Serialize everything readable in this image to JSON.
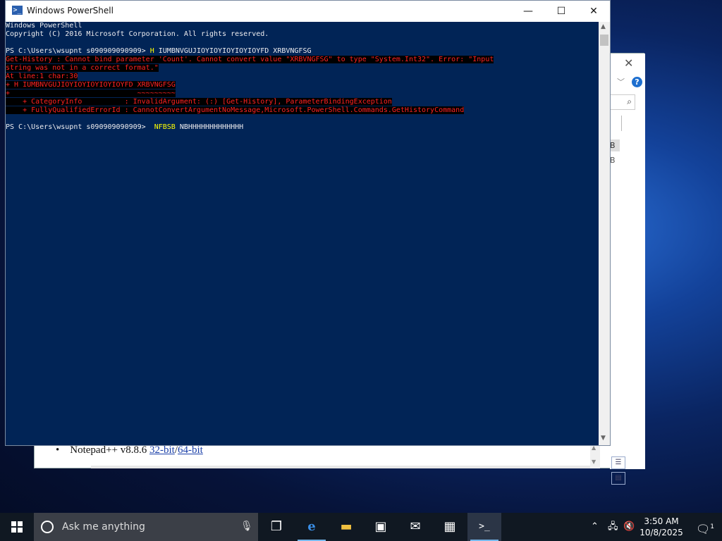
{
  "powershell": {
    "title": "Windows PowerShell",
    "minimize": "—",
    "maximize": "☐",
    "close": "✕",
    "lines": {
      "l1": "Windows PowerShell",
      "l2": "Copyright (C) 2016 Microsoft Corporation. All rights reserved.",
      "l3_prompt": "PS C:\\Users\\wsupnt s090909090909> ",
      "l3_cmd": "H",
      "l3_args": " IUMBNVGUJIOYIOYIOYIOYIOYFD XRBVNGFSG",
      "e1": "Get-History : Cannot bind parameter 'Count'. Cannot convert value \"XRBVNGFSG\" to type \"System.Int32\". Error: \"Input",
      "e2": "string was not in a correct format.\"",
      "e3": "At line:1 char:30",
      "e4": "+ H IUMBNVGUJIOYIOYIOYIOYIOYFD XRBVNGFSG",
      "e5": "+                              ~~~~~~~~~",
      "e6": "    + CategoryInfo          : InvalidArgument: (:) [Get-History], ParameterBindingException",
      "e7": "    + FullyQualifiedErrorId : CannotConvertArgumentNoMessage,Microsoft.PowerShell.Commands.GetHistoryCommand",
      "l4_prompt": "PS C:\\Users\\wsupnt s090909090909>  ",
      "l4_cmd": "NFBSB",
      "l4_args": " NBHHHHHHHHHHHHH"
    }
  },
  "background_window": {
    "list_item_text": "Notepad++ v8.8.6 ",
    "link1": "32-bit",
    "sep": "/",
    "link2": "64-bit",
    "help": "?",
    "b1": "B",
    "b2": "B"
  },
  "taskbar": {
    "search_placeholder": "Ask me anything",
    "time": "3:50 AM",
    "date": "10/8/2025",
    "notif_count": "1"
  },
  "colors": {
    "console_bg": "#012456",
    "error_fg": "#ff2222",
    "command_fg": "#ffff00"
  }
}
